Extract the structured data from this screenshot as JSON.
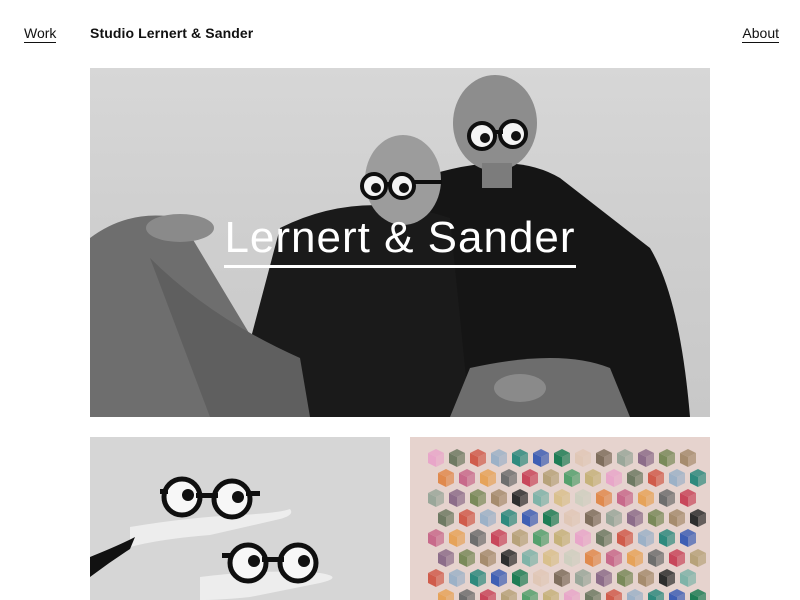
{
  "nav": {
    "work_label": "Work",
    "studio_name": "Studio Lernert & Sander",
    "about_label": "About"
  },
  "hero": {
    "title": "Lernert & Sander"
  },
  "colors": {
    "background": "#ffffff",
    "text": "#111111",
    "cube_palette": [
      "#e8a6c9",
      "#c86a8b",
      "#7a8a5a",
      "#2f8a7e",
      "#b7a27a",
      "#d9c08d",
      "#7f6e5d",
      "#6f7a63",
      "#e6a35a",
      "#a68c6e",
      "#3f5fb4",
      "#55a06d",
      "#cfcfc0",
      "#9aa79a",
      "#d05c4c",
      "#6e6e6e",
      "#2e2e2e",
      "#1f7d55",
      "#c6b27b",
      "#e08a4e",
      "#8d6d8a",
      "#9cb1c7",
      "#c8475b",
      "#7fb3a8",
      "#e0c7b6"
    ]
  }
}
